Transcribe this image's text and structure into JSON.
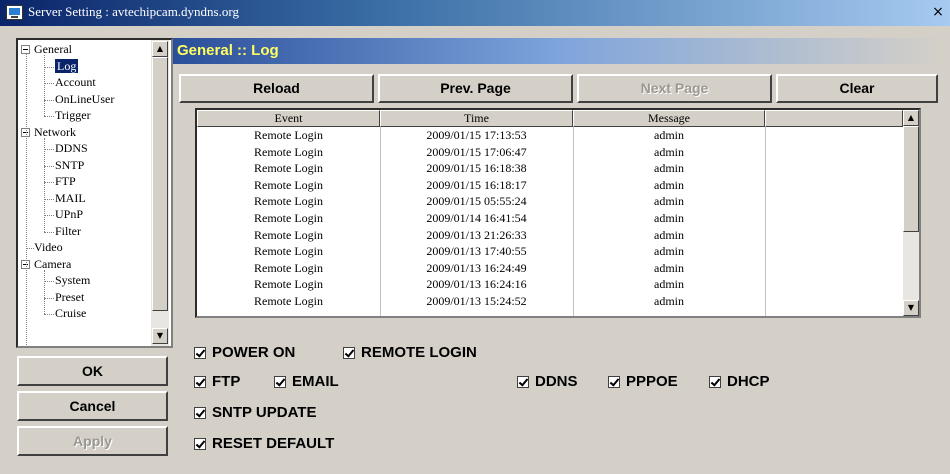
{
  "window": {
    "title": "Server Setting : avtechipcam.dyndns.org",
    "close_label": "×"
  },
  "tree": {
    "items": [
      {
        "label": "General",
        "level": 0,
        "expandable": true
      },
      {
        "label": "Log",
        "level": 1,
        "selected": true
      },
      {
        "label": "Account",
        "level": 1
      },
      {
        "label": "OnLineUser",
        "level": 1
      },
      {
        "label": "Trigger",
        "level": 1
      },
      {
        "label": "Network",
        "level": 0,
        "expandable": true
      },
      {
        "label": "DDNS",
        "level": 1
      },
      {
        "label": "SNTP",
        "level": 1
      },
      {
        "label": "FTP",
        "level": 1
      },
      {
        "label": "MAIL",
        "level": 1
      },
      {
        "label": "UPnP",
        "level": 1
      },
      {
        "label": "Filter",
        "level": 1
      },
      {
        "label": "Video",
        "level": 0
      },
      {
        "label": "Camera",
        "level": 0,
        "expandable": true
      },
      {
        "label": "System",
        "level": 1
      },
      {
        "label": "Preset",
        "level": 1
      },
      {
        "label": "Cruise",
        "level": 1
      }
    ]
  },
  "buttons": {
    "ok": "OK",
    "cancel": "Cancel",
    "apply": "Apply"
  },
  "header": {
    "title": "General :: Log"
  },
  "toolbar": {
    "reload": "Reload",
    "prev_page": "Prev. Page",
    "next_page": "Next Page",
    "clear": "Clear"
  },
  "log": {
    "columns": [
      "Event",
      "Time",
      "Message",
      ""
    ],
    "rows": [
      [
        "Remote Login",
        "2009/01/15 17:13:53",
        "admin"
      ],
      [
        "Remote Login",
        "2009/01/15 17:06:47",
        "admin"
      ],
      [
        "Remote Login",
        "2009/01/15 16:18:38",
        "admin"
      ],
      [
        "Remote Login",
        "2009/01/15 16:18:17",
        "admin"
      ],
      [
        "Remote Login",
        "2009/01/15 05:55:24",
        "admin"
      ],
      [
        "Remote Login",
        "2009/01/14 16:41:54",
        "admin"
      ],
      [
        "Remote Login",
        "2009/01/13 21:26:33",
        "admin"
      ],
      [
        "Remote Login",
        "2009/01/13 17:40:55",
        "admin"
      ],
      [
        "Remote Login",
        "2009/01/13 16:24:49",
        "admin"
      ],
      [
        "Remote Login",
        "2009/01/13 16:24:16",
        "admin"
      ],
      [
        "Remote Login",
        "2009/01/13 15:24:52",
        "admin"
      ]
    ]
  },
  "filters": {
    "power_on": {
      "label": "POWER ON",
      "checked": true
    },
    "remote_login": {
      "label": "REMOTE LOGIN",
      "checked": true
    },
    "ftp": {
      "label": "FTP",
      "checked": true
    },
    "email": {
      "label": "EMAIL",
      "checked": true
    },
    "ddns": {
      "label": "DDNS",
      "checked": true
    },
    "pppoe": {
      "label": "PPPOE",
      "checked": true
    },
    "dhcp": {
      "label": "DHCP",
      "checked": true
    },
    "sntp_update": {
      "label": "SNTP UPDATE",
      "checked": true
    },
    "reset_default": {
      "label": "RESET DEFAULT",
      "checked": true
    }
  }
}
